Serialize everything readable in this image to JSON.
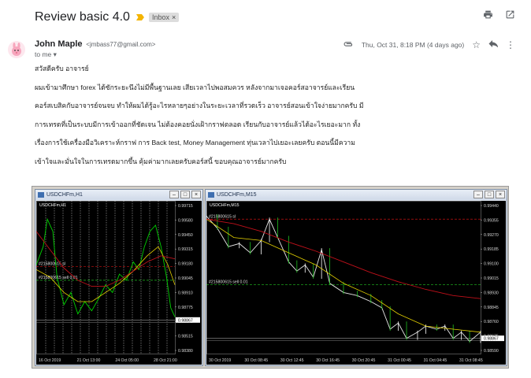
{
  "email": {
    "subject": "Review basic 4.0",
    "label": "Inbox",
    "sender_name": "John Maple",
    "sender_email": "<jmbass77@gmail.com>",
    "recipient": "to me",
    "timestamp": "Thu, Oct 31, 8:18 PM (4 days ago)",
    "body": [
      "สวัสดีครับ อาจารย์",
      "ผมเข้ามาศึกษา forex ได้ซักระยะนึงไม่มีพื้นฐานเลย เสียเวลาไปพอสมควร หลังจากมาเจอคอร์สอาจารย์และเรียน",
      "คอร์สเบสิคกับอาจารย์จนจบ ทำให้ผมได้รู้อะไรหลายๆอย่างในระยะเวลาที่รวดเร็ว อาจารย์สอนเข้าใจง่ายมากครับ มี",
      "การเทรดที่เป็นระบบมีการเข้าออกที่ชัดเจน ไม่ต้องคอยนั่งเฝ้ากราฟตลอด เรียนกับอาจารย์แล้วได้อะไรเยอะมาก ทั้ง",
      "เรื่องการใช้เครื่องมือวิเคราะห์กราฟ การ Back test, Money Management ทุ่นเวลาไปเยอะเลยครับ ตอนนี้มีความ",
      "เข้าใจและมั่นใจในการเทรดมากขึ้น คุ้มค่ามากเลยครับคอร์สนี้ ขอบคุณอาจารย์มากครับ"
    ]
  },
  "icons": {
    "importance": "importance-marker-icon",
    "print": "print-icon",
    "open_new": "open-in-new-window-icon",
    "attachment": "attachment-icon",
    "star": "star-icon",
    "reply": "reply-icon",
    "more": "more-vert-icon"
  },
  "colors": {
    "importance": "#f4b400",
    "chart_bg": "#000000",
    "ma_fast": "#e6d200",
    "ma_slow": "#c0101a",
    "price": "#00d000",
    "order_line": "#c21212",
    "sell_line": "#20c020"
  },
  "charts": [
    {
      "window_title": "USDCHFm,H1",
      "symbol_label": "USDCHFm,H1",
      "order_label": "#215800615 sl",
      "sell_label": "#215800615 sell 0.01",
      "ticks_y": [
        "0.99715",
        "0.99580",
        "0.99450",
        "0.99315",
        "0.99180",
        "0.99045",
        "0.98910",
        "0.98775",
        "0.98645",
        "0.98515",
        "0.98380"
      ],
      "current_price": "0.98867",
      "ticks_x": [
        "16 Oct 2019",
        "21 Oct 13:00",
        "24 Oct 05:00",
        "28 Oct 21:00"
      ]
    },
    {
      "window_title": "USDCHFm,M15",
      "symbol_label": "USDCHFm,M15",
      "order_label": "#215800615 sl",
      "sell_label": "#215800615 sell 0.01",
      "ticks_y": [
        "0.99440",
        "0.99355",
        "0.99270",
        "0.99185",
        "0.99100",
        "0.99015",
        "0.98930",
        "0.98845",
        "0.98760",
        "0.98675",
        "0.98590"
      ],
      "current_price": "0.98867",
      "ticks_x": [
        "30 Oct 2019",
        "30 Oct 08:45",
        "30 Oct 12:45",
        "30 Oct 16:45",
        "30 Oct 20:45",
        "31 Oct 00:45",
        "31 Oct 04:45",
        "31 Oct 08:45"
      ]
    }
  ]
}
